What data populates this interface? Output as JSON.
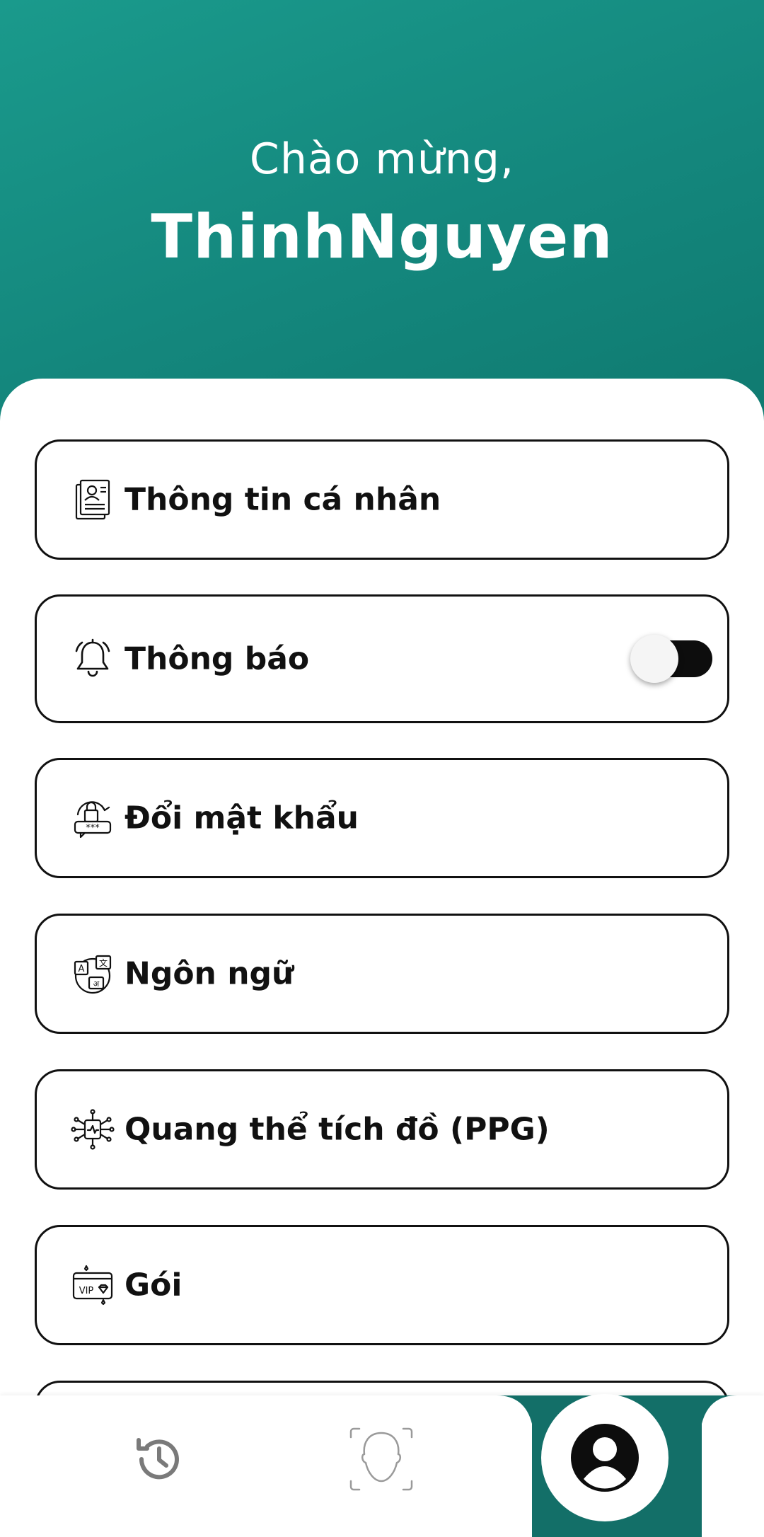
{
  "header": {
    "greeting": "Chào mừng,",
    "username": "ThinhNguyen"
  },
  "colors": {
    "accent": "#14877d",
    "toggle_track": "#0d0d0d",
    "text": "#111111"
  },
  "menu": {
    "personal_info": {
      "label": "Thông tin cá nhân",
      "icon": "id-card-icon"
    },
    "notifications": {
      "label": "Thông báo",
      "icon": "bell-icon",
      "toggle_on": true
    },
    "change_password": {
      "label": "Đổi mật khẩu",
      "icon": "password-lock-icon"
    },
    "language": {
      "label": "Ngôn ngữ",
      "icon": "translate-globe-icon"
    },
    "ppg": {
      "label": "Quang thể tích đồ (PPG)",
      "icon": "ppg-chip-icon"
    },
    "plan": {
      "label": "Gói",
      "icon": "vip-card-icon"
    }
  },
  "bottom_nav": {
    "items": [
      {
        "icon": "history-icon",
        "active": false
      },
      {
        "icon": "face-scan-icon",
        "active": false
      },
      {
        "icon": "profile-icon",
        "active": true
      }
    ]
  }
}
